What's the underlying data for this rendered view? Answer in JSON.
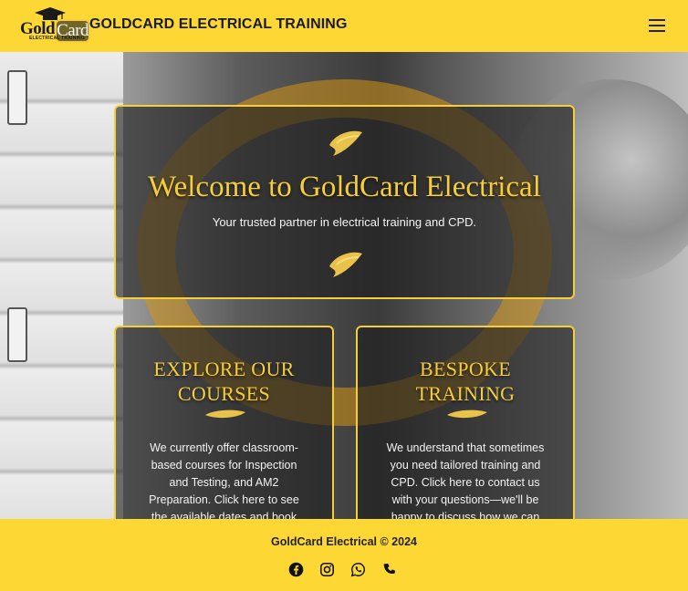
{
  "header": {
    "logo_word_gold": "Gold",
    "logo_word_card": "Card",
    "logo_tagline": "ELECTRICAL TRAINING",
    "brand_title": "GOLDCARD ELECTRICAL TRAINING",
    "menu_icon": "hamburger-menu-icon"
  },
  "hero": {
    "title": "Welcome to GoldCard Electrical",
    "subtitle": "Your trusted partner in electrical training and CPD."
  },
  "cards": [
    {
      "title": "EXPLORE OUR COURSES",
      "body": "We currently offer classroom-based courses for Inspection and Testing, and AM2 Preparation. Click here to see the available dates and book"
    },
    {
      "title": "BESPOKE TRAINING",
      "body": "We understand that sometimes you need tailored training and CPD. Click here to contact us with your questions—we'll be happy to discuss how we can"
    }
  ],
  "footer": {
    "copyright": "GoldCard Electrical © 2024",
    "socials": [
      "facebook-icon",
      "instagram-icon",
      "whatsapp-icon",
      "phone-icon"
    ]
  },
  "colors": {
    "brand_yellow": "#fdd835",
    "gold_text": "#f6cd3b",
    "card_bg": "rgba(30,30,30,0.62)"
  }
}
